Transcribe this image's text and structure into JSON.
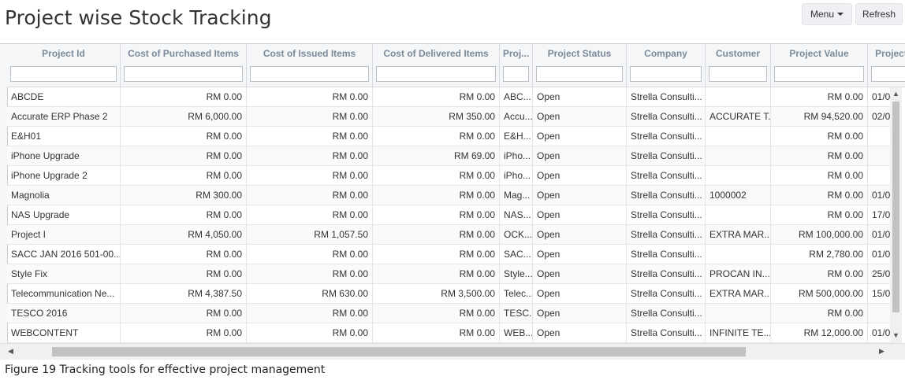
{
  "page": {
    "title": "Project wise Stock Tracking"
  },
  "toolbar": {
    "menu_label": "Menu",
    "refresh_label": "Refresh"
  },
  "columns": [
    "Project Id",
    "Cost of Purchased Items",
    "Cost of Issued Items",
    "Cost of Delivered Items",
    "Proj...",
    "Project Status",
    "Company",
    "Customer",
    "Project Value",
    "Project"
  ],
  "rows": [
    [
      "ABCDE",
      "RM 0.00",
      "RM 0.00",
      "RM 0.00",
      "ABC...",
      "Open",
      "Strella Consulti...",
      "",
      "RM 0.00",
      "01/0"
    ],
    [
      "Accurate ERP Phase 2",
      "RM 6,000.00",
      "RM 0.00",
      "RM 350.00",
      "Accu...",
      "Open",
      "Strella Consulti...",
      "ACCURATE T...",
      "RM 94,520.00",
      "02/0"
    ],
    [
      "E&H01",
      "RM 0.00",
      "RM 0.00",
      "RM 0.00",
      "E&H...",
      "Open",
      "Strella Consulti...",
      "",
      "RM 0.00",
      ""
    ],
    [
      "iPhone Upgrade",
      "RM 0.00",
      "RM 0.00",
      "RM 69.00",
      "iPho...",
      "Open",
      "Strella Consulti...",
      "",
      "RM 0.00",
      ""
    ],
    [
      "iPhone Upgrade 2",
      "RM 0.00",
      "RM 0.00",
      "RM 0.00",
      "iPho...",
      "Open",
      "Strella Consulti...",
      "",
      "RM 0.00",
      ""
    ],
    [
      "Magnolia",
      "RM 300.00",
      "RM 0.00",
      "RM 0.00",
      "Mag...",
      "Open",
      "Strella Consulti...",
      "1000002",
      "RM 0.00",
      "01/0"
    ],
    [
      "NAS Upgrade",
      "RM 0.00",
      "RM 0.00",
      "RM 0.00",
      "NAS...",
      "Open",
      "Strella Consulti...",
      "",
      "RM 0.00",
      "17/0"
    ],
    [
      "Project I",
      "RM 4,050.00",
      "RM 1,057.50",
      "RM 0.00",
      "OCK...",
      "Open",
      "Strella Consulti...",
      "EXTRA MAR...",
      "RM 100,000.00",
      "01/0"
    ],
    [
      "SACC JAN 2016 501-00...",
      "RM 0.00",
      "RM 0.00",
      "RM 0.00",
      "SAC...",
      "Open",
      "Strella Consulti...",
      "",
      "RM 2,780.00",
      "01/0"
    ],
    [
      "Style Fix",
      "RM 0.00",
      "RM 0.00",
      "RM 0.00",
      "Style...",
      "Open",
      "Strella Consulti...",
      "PROCAN IN...",
      "RM 0.00",
      "25/0"
    ],
    [
      "Telecommunication Ne...",
      "RM 4,387.50",
      "RM 630.00",
      "RM 3,500.00",
      "Telec...",
      "Open",
      "Strella Consulti...",
      "EXTRA MAR...",
      "RM 500,000.00",
      "15/0"
    ],
    [
      "TESCO 2016",
      "RM 0.00",
      "RM 0.00",
      "RM 0.00",
      "TESC...",
      "Open",
      "Strella Consulti...",
      "",
      "RM 0.00",
      ""
    ],
    [
      "WEBCONTENT",
      "RM 0.00",
      "RM 0.00",
      "RM 0.00",
      "WEB...",
      "Open",
      "Strella Consulti...",
      "INFINITE TE...",
      "RM 12,000.00",
      "01/0"
    ]
  ],
  "caption": "Figure 19 Tracking tools for effective project management"
}
